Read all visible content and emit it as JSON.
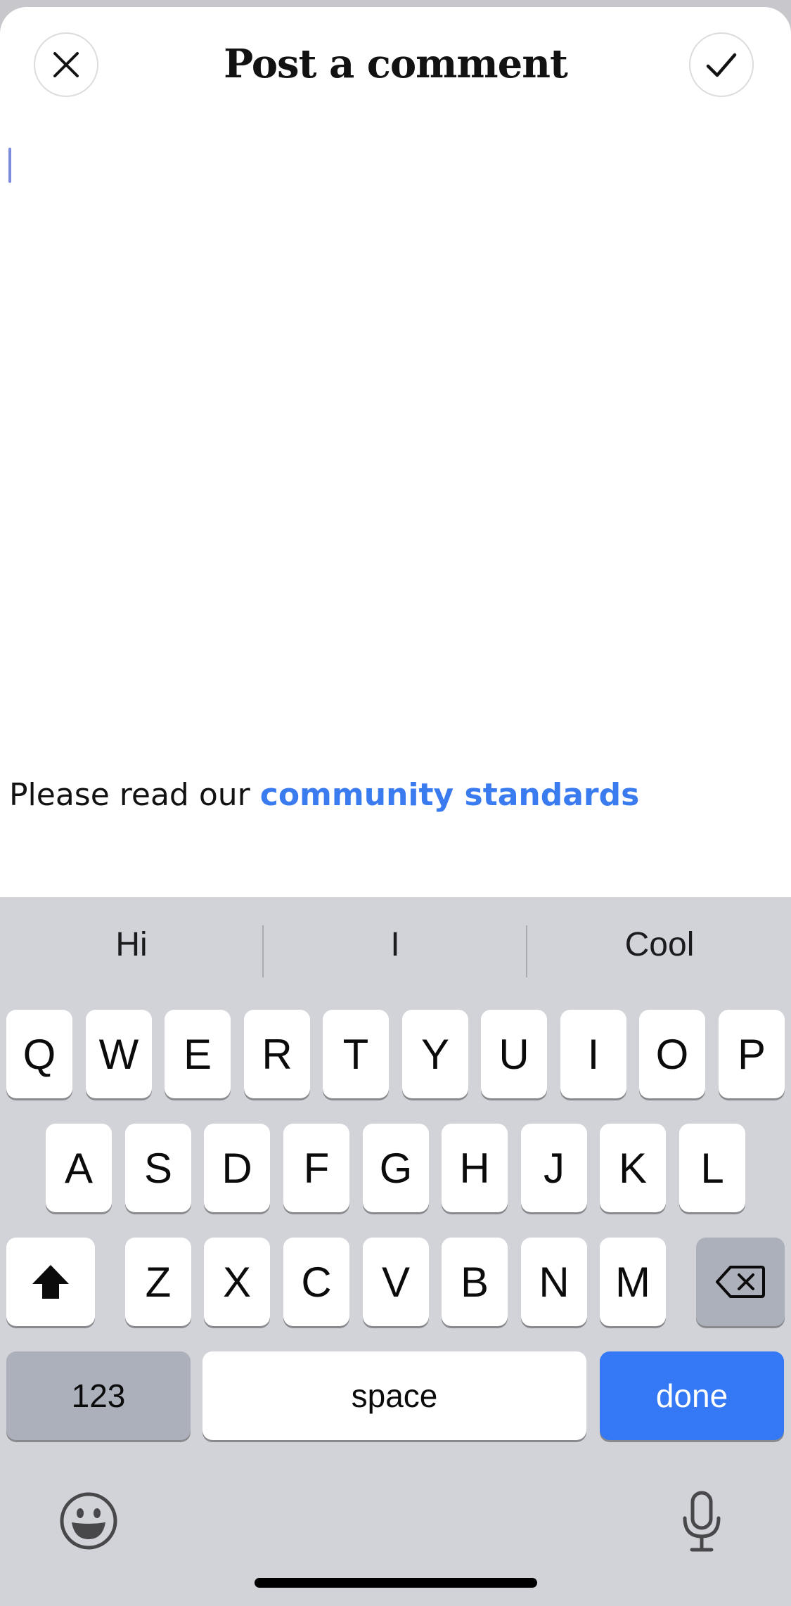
{
  "header": {
    "title": "Post a comment",
    "close_icon": "close-icon",
    "confirm_icon": "checkmark-icon"
  },
  "comment": {
    "value": ""
  },
  "footer_note": {
    "prefix": "Please read our ",
    "link": "community standards"
  },
  "keyboard": {
    "suggestions": [
      "Hi",
      "I",
      "Cool"
    ],
    "row1": [
      "Q",
      "W",
      "E",
      "R",
      "T",
      "Y",
      "U",
      "I",
      "O",
      "P"
    ],
    "row2": [
      "A",
      "S",
      "D",
      "F",
      "G",
      "H",
      "J",
      "K",
      "L"
    ],
    "row3": [
      "Z",
      "X",
      "C",
      "V",
      "B",
      "N",
      "M"
    ],
    "numbers_label": "123",
    "space_label": "space",
    "done_label": "done",
    "shift_icon": "shift-icon",
    "backspace_icon": "backspace-icon",
    "emoji_icon": "emoji-icon",
    "mic_icon": "microphone-icon"
  },
  "colors": {
    "link": "#3a7bf0",
    "done_key": "#3478f6",
    "caret": "#7d8bdd"
  }
}
